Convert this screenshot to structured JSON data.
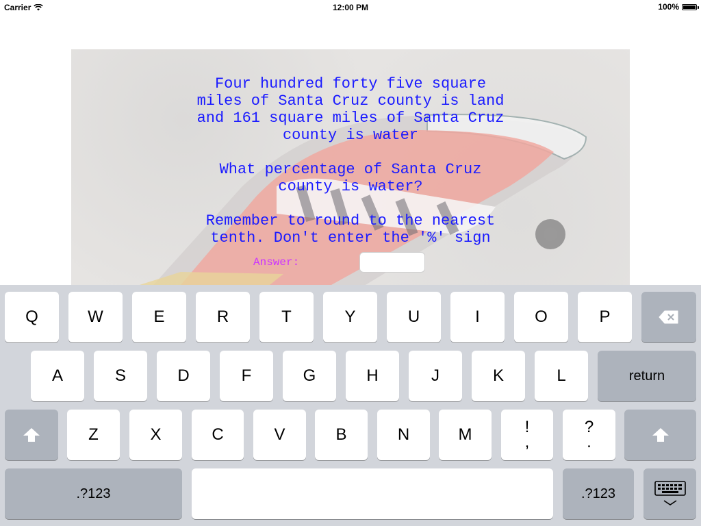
{
  "status_bar": {
    "carrier": "Carrier",
    "time": "12:00 PM",
    "battery": "100%",
    "battery_level": 1.0
  },
  "question": {
    "paragraphs": [
      "Four hundred forty five square\nmiles of Santa Cruz county is land\nand 161 square miles of Santa Cruz\ncounty is water",
      "What percentage of Santa Cruz\ncounty is water?",
      "Remember to round to the nearest\ntenth. Don't enter the '%' sign"
    ],
    "text_color": "#1a1aff"
  },
  "answer": {
    "label": "Answer:",
    "value": "",
    "label_color": "#cc33ff"
  },
  "keyboard": {
    "row1": [
      "Q",
      "W",
      "E",
      "R",
      "T",
      "Y",
      "U",
      "I",
      "O",
      "P"
    ],
    "row2": [
      "A",
      "S",
      "D",
      "F",
      "G",
      "H",
      "J",
      "K",
      "L"
    ],
    "row3": [
      "Z",
      "X",
      "C",
      "V",
      "B",
      "N",
      "M"
    ],
    "punct1": [
      "!",
      ","
    ],
    "punct2": [
      "?",
      "."
    ],
    "return_label": "return",
    "numbers_label": ".?123",
    "numbers_label_right": ".?123",
    "icons": [
      "delete-icon",
      "shift-icon",
      "keyboard-dismiss-icon"
    ]
  }
}
